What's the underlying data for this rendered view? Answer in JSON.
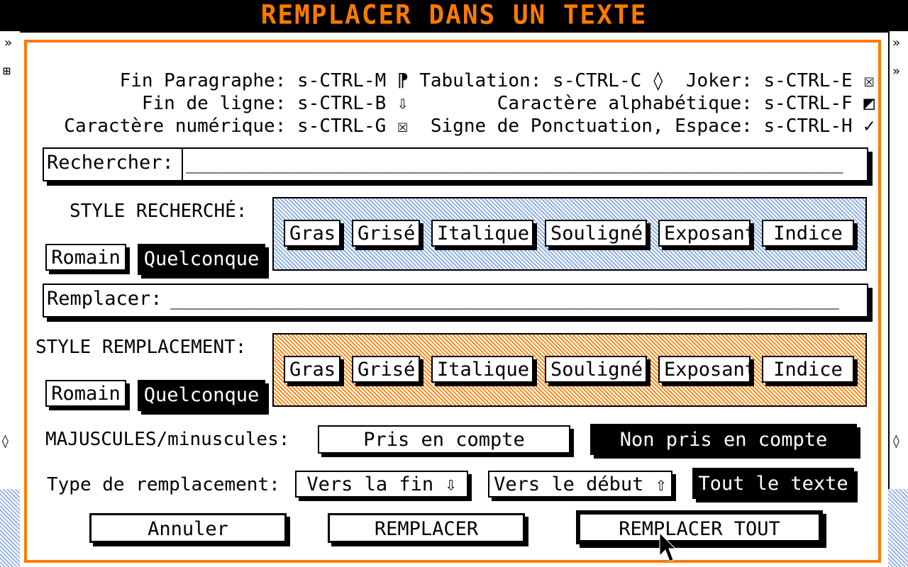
{
  "title": "REMPLACER DANS UN TEXTE",
  "shortcuts": {
    "line1": "Fin Paragraphe: s-CTRL-M ⁋ Tabulation: s-CTRL-C ◊  Joker: s-CTRL-E ☒",
    "line2": "Fin de ligne: s-CTRL-B ⇩        Caractère alphabétique: s-CTRL-F ◩",
    "line3": "Caractère numérique: s-CTRL-G ☒  Signe de Ponctuation, Espace: s-CTRL-H ✓"
  },
  "search": {
    "label": "Rechercher:",
    "value": "_________________________________________________________"
  },
  "search_style": {
    "heading": "STYLE RECHERCHÉ:",
    "romain": "Romain",
    "quelconque": "Quelconque",
    "options": [
      "Gras",
      "Grisé",
      "Italique",
      "Souligné",
      "Exposant",
      "Indice"
    ]
  },
  "replace": {
    "label": "Remplacer:",
    "value": "__________________________________________________________"
  },
  "replace_style": {
    "heading": "STYLE REMPLACEMENT:",
    "romain": "Romain",
    "quelconque": "Quelconque",
    "options": [
      "Gras",
      "Grisé",
      "Italique",
      "Souligné",
      "Exposant",
      "Indice"
    ]
  },
  "case": {
    "label": "MAJUSCULES/minuscules:",
    "option1": "Pris en compte",
    "option2": "Non pris en compte"
  },
  "replace_type": {
    "label": "Type de remplacement:",
    "option1": "Vers la fin ⇩",
    "option2": "Vers le début ⇧",
    "option3": "Tout le texte"
  },
  "actions": {
    "cancel": "Annuler",
    "replace": "REMPLACER",
    "replace_all": "REMPLACER TOUT"
  },
  "colors": {
    "accent_orange": "#ff7a00",
    "pattern_blue": "#8fb0e8",
    "pattern_orange": "#ff8a20"
  }
}
